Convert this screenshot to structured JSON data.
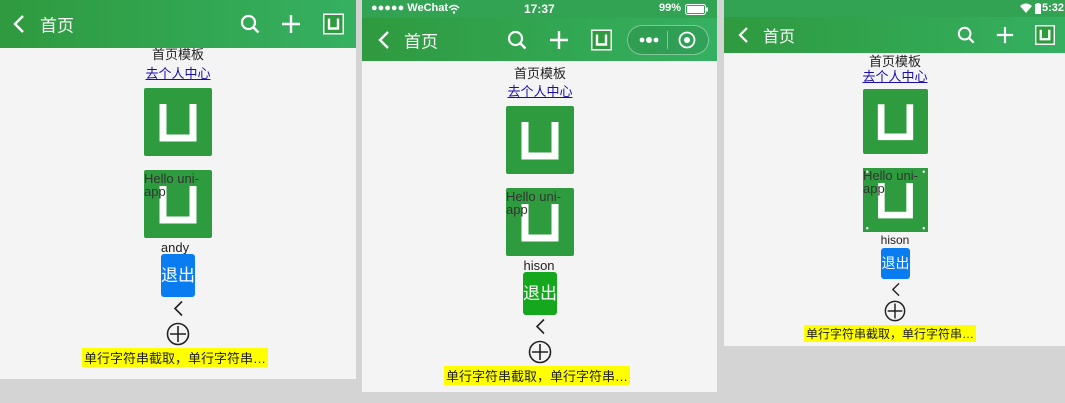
{
  "nav_title": "首页",
  "template_title": "首页模板",
  "link_text": "去个人中心",
  "hello_text": "Hello uni-app",
  "ellipsis_text": "单行字符串截取，单行字符串…",
  "status_bar": {
    "carrier": "●●●●● WeChat",
    "time": "17:37",
    "battery": "99%",
    "android_time": "5:32"
  },
  "panels": [
    {
      "id": "h5",
      "username": "andy",
      "logout_label": "退出",
      "logout_color": "#0a7cf2"
    },
    {
      "id": "wechat",
      "username": "hison",
      "logout_label": "退出",
      "logout_color": "#15a81e"
    },
    {
      "id": "android",
      "username": "hison",
      "logout_label": "退出",
      "logout_color": "#0a7cf2"
    }
  ],
  "colors": {
    "nav_green": "#31a352",
    "logo_green": "#2e9b3e",
    "highlight": "#ffff00",
    "link": "#1a0dab"
  },
  "icons": [
    "back-icon",
    "search-icon",
    "plus-icon",
    "u-logo-icon",
    "more-dots-icon",
    "close-target-icon",
    "chevron-left-icon",
    "circle-plus-icon"
  ]
}
